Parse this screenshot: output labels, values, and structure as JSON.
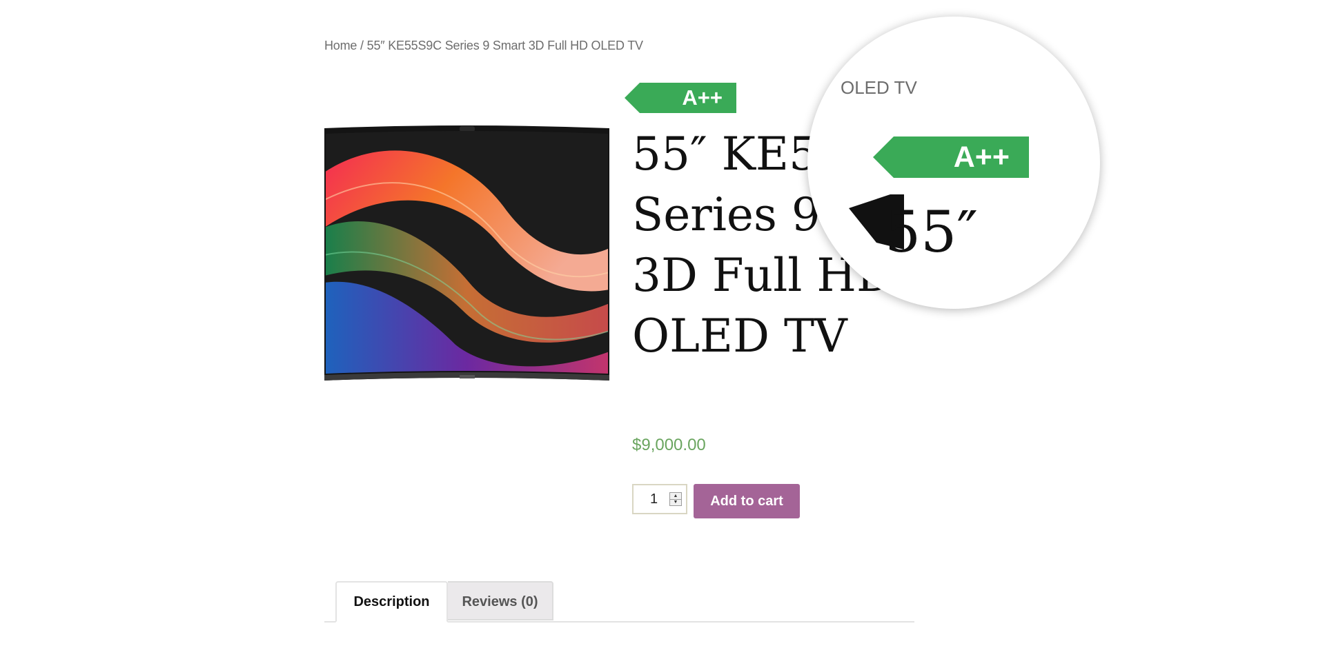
{
  "breadcrumb": {
    "home_label": "Home",
    "separator": "/",
    "current": "55″ KE55S9C Series 9 Smart 3D Full HD OLED TV"
  },
  "product": {
    "energy_rating": "A++",
    "title": "55″ KE55S9C Series 9 Smart 3D Full HD OLED TV",
    "price": "$9,000.00",
    "quantity": "1",
    "add_to_cart_label": "Add to cart",
    "image_icon": "tv-product-image"
  },
  "tabs": [
    {
      "label": "Description",
      "active": true
    },
    {
      "label": "Reviews (0)",
      "active": false
    }
  ],
  "magnifier": {
    "crumb_fragment": "OLED TV",
    "badge": "A++",
    "title_fragment": "55″"
  },
  "colors": {
    "badge_green": "#3aaa57",
    "price_green": "#6aa55f",
    "button_purple": "#a46497",
    "tab_inactive_bg": "#ebe9eb"
  }
}
